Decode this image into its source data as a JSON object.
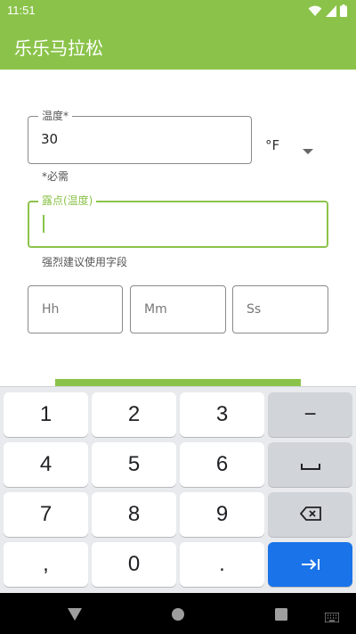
{
  "status_bar": {
    "time": "11:51"
  },
  "app": {
    "title": "乐乐马拉松"
  },
  "temperature": {
    "label": "温度*",
    "value": "30",
    "helper": "*必需",
    "unit": "°F"
  },
  "dew_point": {
    "label": "露点(温度)",
    "value": "",
    "helper": "强烈建议使用字段"
  },
  "time_fields": {
    "hours_placeholder": "Hh",
    "minutes_placeholder": "Mm",
    "seconds_placeholder": "Ss"
  },
  "keyboard": {
    "rows": [
      [
        "1",
        "2",
        "3",
        "−"
      ],
      [
        "4",
        "5",
        "6",
        "␣"
      ],
      [
        "7",
        "8",
        "9",
        "⌫"
      ],
      [
        ",",
        "0",
        ".",
        "⇥"
      ]
    ]
  },
  "icons": {
    "wifi": "wifi-icon",
    "signal": "signal-icon",
    "battery": "battery-icon",
    "dropdown": "chevron-down-icon",
    "back": "back-icon",
    "home": "home-icon",
    "recents": "recents-icon",
    "keyboard": "keyboard-icon"
  },
  "colors": {
    "accent": "#8bc34a",
    "key_action": "#1a73e8"
  }
}
